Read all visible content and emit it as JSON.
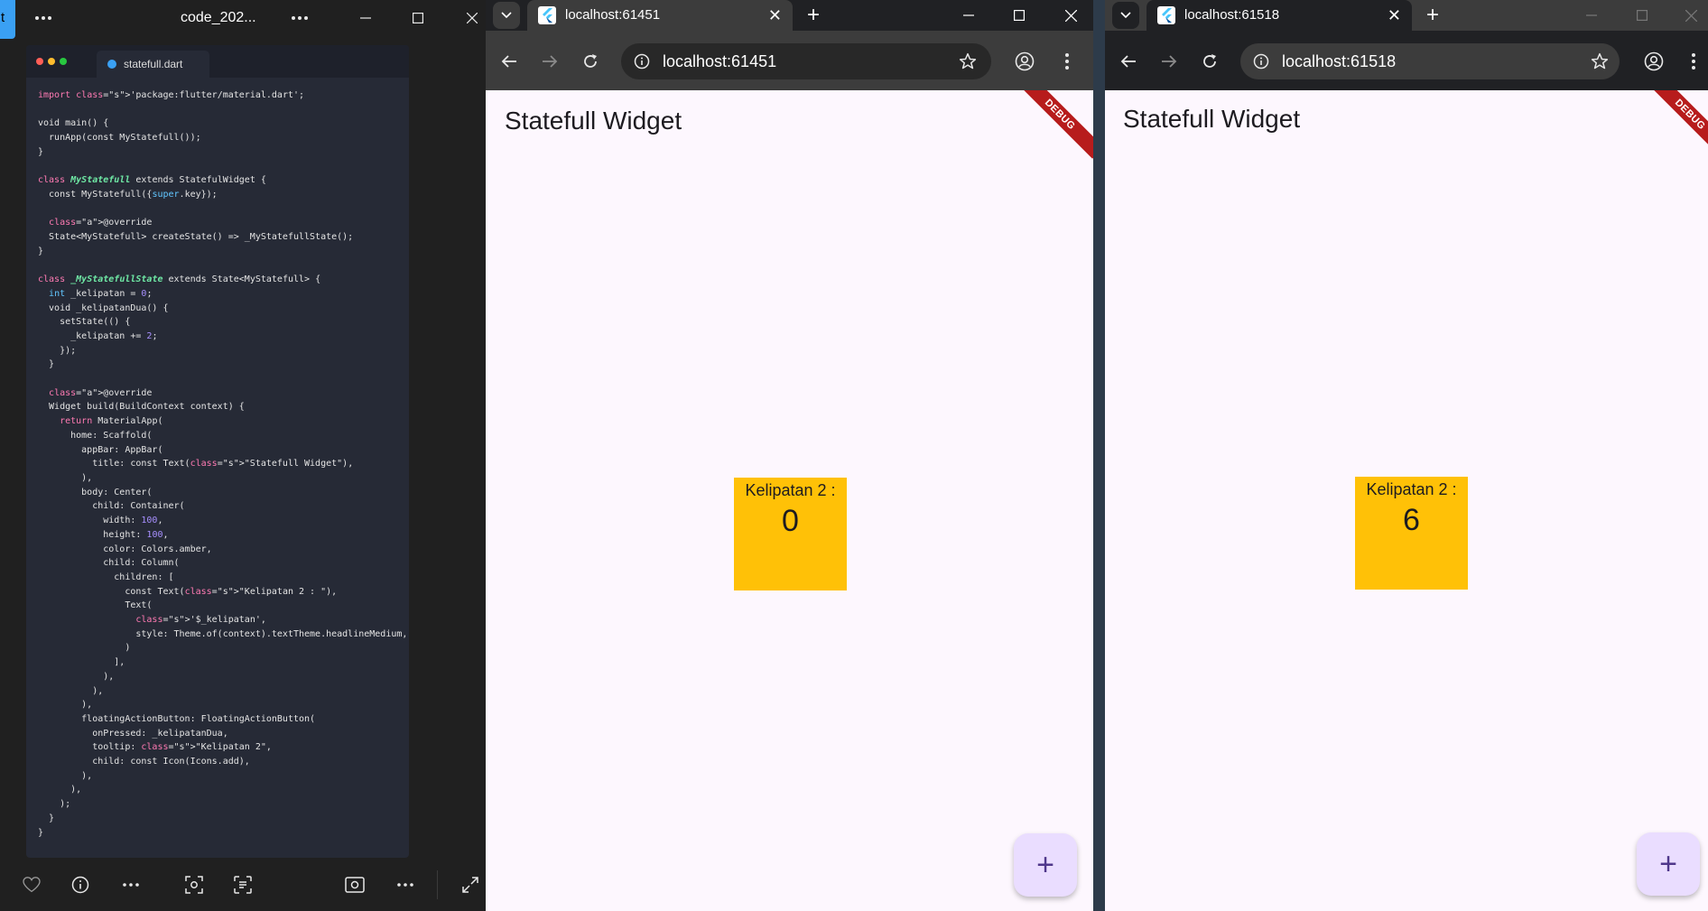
{
  "viewer": {
    "accent_letter": "t",
    "title": "code_202...",
    "code_tab": "statefull.dart",
    "code_lines": [
      "import 'package:flutter/material.dart';",
      "",
      "void main() {",
      "  runApp(const MyStatefull());",
      "}",
      "",
      "class MyStatefull extends StatefulWidget {",
      "  const MyStatefull({super.key});",
      "",
      "  @override",
      "  State<MyStatefull> createState() => _MyStatefullState();",
      "}",
      "",
      "class _MyStatefullState extends State<MyStatefull> {",
      "  int _kelipatan = 0;",
      "  void _kelipatanDua() {",
      "    setState(() {",
      "      _kelipatan += 2;",
      "    });",
      "  }",
      "",
      "  @override",
      "  Widget build(BuildContext context) {",
      "    return MaterialApp(",
      "      home: Scaffold(",
      "        appBar: AppBar(",
      "          title: const Text(\"Statefull Widget\"),",
      "        ),",
      "        body: Center(",
      "          child: Container(",
      "            width: 100,",
      "            height: 100,",
      "            color: Colors.amber,",
      "            child: Column(",
      "              children: [",
      "                const Text(\"Kelipatan 2 : \"),",
      "                Text(",
      "                  '$_kelipatan',",
      "                  style: Theme.of(context).textTheme.headlineMedium,",
      "                )",
      "              ],",
      "            ),",
      "          ),",
      "        ),",
      "        floatingActionButton: FloatingActionButton(",
      "          onPressed: _kelipatanDua,",
      "          tooltip: \"Kelipatan 2\",",
      "          child: const Icon(Icons.add),",
      "        ),",
      "      ),",
      "    );",
      "  }",
      "}"
    ],
    "icons": [
      "heart-icon",
      "info-icon",
      "more-icon",
      "visual-search-icon",
      "text-scan-icon",
      "capture-icon",
      "more-icon",
      "expand-icon"
    ]
  },
  "browser1": {
    "tab_title": "localhost:61451",
    "url": "localhost:61451",
    "app_title": "Statefull Widget",
    "debug_label": "DEBUG",
    "box_label": "Kelipatan 2 :",
    "box_value": "0",
    "fab_symbol": "+"
  },
  "browser2": {
    "tab_title": "localhost:61518",
    "url": "localhost:61518",
    "app_title": "Statefull Widget",
    "debug_label": "DEBUG",
    "box_label": "Kelipatan 2 :",
    "box_value": "6",
    "fab_symbol": "+"
  },
  "colors": {
    "amber": "#ffc107",
    "fab": "#eaddff",
    "debug": "#b71c1c",
    "viewer_accent": "#3aa0f3"
  }
}
